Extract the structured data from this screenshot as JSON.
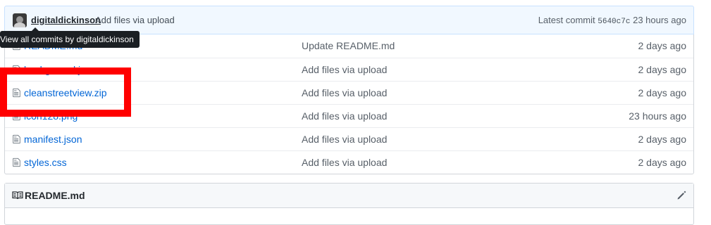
{
  "commit": {
    "author": "digitaldickinson",
    "message": "Add files via upload",
    "latest_label": "Latest commit",
    "sha": "5640c7c",
    "age": "23 hours ago"
  },
  "tooltip": {
    "text": "View all commits by digitaldickinson"
  },
  "files": [
    {
      "name": "README.md",
      "commit": "Update README.md",
      "age": "2 days ago"
    },
    {
      "name": "background.js",
      "commit": "Add files via upload",
      "age": "2 days ago"
    },
    {
      "name": "cleanstreetview.zip",
      "commit": "Add files via upload",
      "age": "2 days ago"
    },
    {
      "name": "icon128.png",
      "commit": "Add files via upload",
      "age": "23 hours ago"
    },
    {
      "name": "manifest.json",
      "commit": "Add files via upload",
      "age": "2 days ago"
    },
    {
      "name": "styles.css",
      "commit": "Add files via upload",
      "age": "2 days ago"
    }
  ],
  "readme": {
    "title": "README.md"
  },
  "icons": {
    "file": "file-icon",
    "book": "book-icon",
    "pencil": "pencil-icon"
  },
  "colors": {
    "link": "#0366d6",
    "highlight": "#ff0000",
    "commit_bg": "#f1f8ff"
  }
}
